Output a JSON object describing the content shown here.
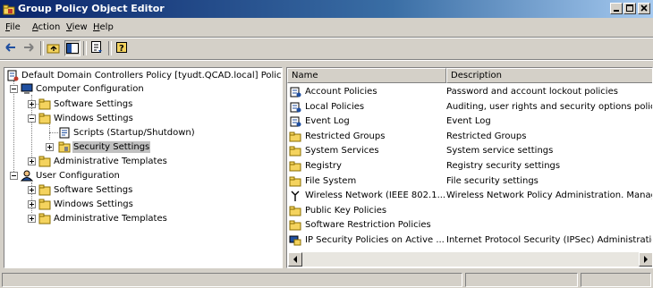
{
  "window": {
    "title": "Group Policy Object Editor",
    "controls": [
      "minimize",
      "maximize",
      "close"
    ]
  },
  "menu": [
    {
      "label": "File"
    },
    {
      "label": "Action"
    },
    {
      "label": "View"
    },
    {
      "label": "Help"
    }
  ],
  "toolbar": {
    "buttons": [
      "back-arrow-icon",
      "forward-arrow-icon",
      "up-folder-icon",
      "show-hide-tree-icon",
      "export-list-icon",
      "help-icon"
    ]
  },
  "tree": {
    "root": "Default Domain Controllers Policy [tyudt.QCAD.local] Policy",
    "computer_config": "Computer Configuration",
    "software_settings": "Software Settings",
    "windows_settings": "Windows Settings",
    "scripts": "Scripts (Startup/Shutdown)",
    "security_settings": "Security Settings",
    "admin_templates": "Administrative Templates",
    "user_config": "User Configuration",
    "user_software_settings": "Software Settings",
    "user_windows_settings": "Windows Settings",
    "user_admin_templates": "Administrative Templates"
  },
  "list": {
    "columns": {
      "name": "Name",
      "description": "Description"
    },
    "rows": [
      {
        "name": "Account Policies",
        "description": "Password and account lockout policies",
        "icon": "policy-icon"
      },
      {
        "name": "Local Policies",
        "description": "Auditing, user rights and security options policies",
        "icon": "policy-icon"
      },
      {
        "name": "Event Log",
        "description": "Event Log",
        "icon": "policy-icon"
      },
      {
        "name": "Restricted Groups",
        "description": "Restricted Groups",
        "icon": "folder-icon"
      },
      {
        "name": "System Services",
        "description": "System service settings",
        "icon": "folder-icon"
      },
      {
        "name": "Registry",
        "description": "Registry security settings",
        "icon": "folder-icon"
      },
      {
        "name": "File System",
        "description": "File security settings",
        "icon": "folder-icon"
      },
      {
        "name": "Wireless Network (IEEE 802.1...",
        "description": "Wireless Network Policy Administration. Manage I",
        "icon": "antenna-icon"
      },
      {
        "name": "Public Key Policies",
        "description": "",
        "icon": "folder-icon"
      },
      {
        "name": "Software Restriction Policies",
        "description": "",
        "icon": "folder-icon"
      },
      {
        "name": "IP Security Policies on Active ...",
        "description": "Internet Protocol Security (IPSec) Administration",
        "icon": "ipsec-icon"
      }
    ]
  },
  "colors": {
    "title_start": "#0a246a",
    "title_end": "#a6caf0",
    "folder": "#f4d35e",
    "chrome": "#d4d0c8"
  }
}
